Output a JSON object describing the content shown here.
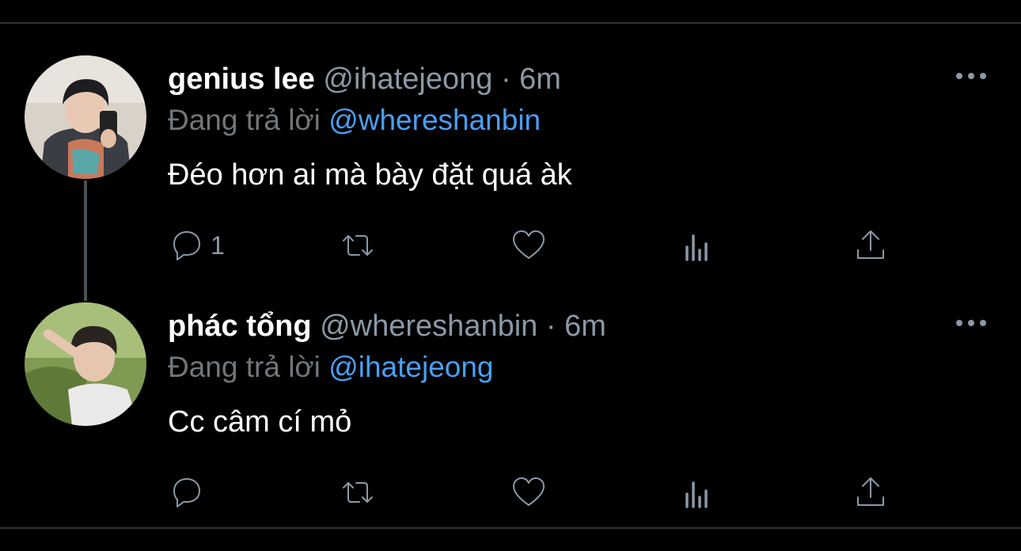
{
  "tweets": [
    {
      "name": "genius lee",
      "handle": "@ihatejeong",
      "separator": "·",
      "time": "6m",
      "reply_prefix": "Đang trả lời",
      "reply_to": "@whereshanbin",
      "text": "Đéo hơn ai mà bày đặt quá àk",
      "reply_count": "1"
    },
    {
      "name": "phác tổng",
      "handle": "@whereshanbin",
      "separator": "·",
      "time": "6m",
      "reply_prefix": "Đang trả lời",
      "reply_to": "@ihatejeong",
      "text": "Cc câm cí mỏ",
      "reply_count": ""
    }
  ],
  "icons": {
    "more": "more-horizontal-icon",
    "reply": "reply-icon",
    "retweet": "retweet-icon",
    "like": "heart-icon",
    "stats": "analytics-icon",
    "share": "share-icon"
  },
  "colors": {
    "background": "#000000",
    "secondary_text": "#8b98a5",
    "link": "#4a9ff5",
    "divider": "#2f3336"
  }
}
